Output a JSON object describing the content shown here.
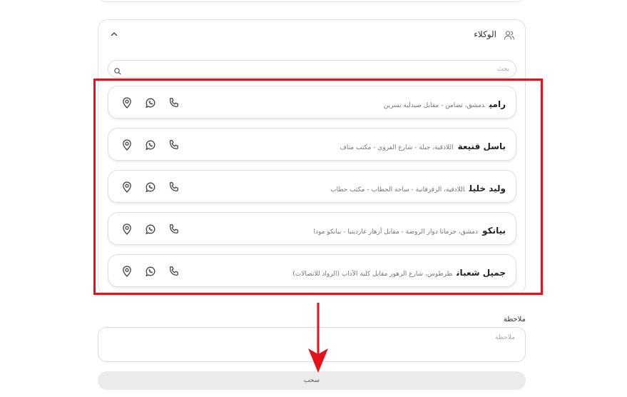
{
  "agents_section": {
    "title": "الوكلاء",
    "search_placeholder": "بحث",
    "agents": [
      {
        "name": "رامي",
        "address": "دمشق، تضامن - مقابل صيدلية نسرين"
      },
      {
        "name": "باسل قنيعة",
        "address": "اللاذقية، جبلة - شارع الفروي - مكتب مناف"
      },
      {
        "name": "وليد خليل",
        "address": "اللاذقية، الزقزقانية - ساحة الحطاب - مكتب حطاب"
      },
      {
        "name": "بيانكو",
        "address": "دمشق، جرمانا دوار الروضة - مقابل أزهار غاردينيا - بيانكو مودا"
      },
      {
        "name": "جميل شعبان",
        "address": "طرطوس، شارع الزهور مقابل كلية الآداب (الرواد للاتصالات)"
      }
    ],
    "action_icons": [
      "location-pin-icon",
      "whatsapp-icon",
      "phone-icon"
    ]
  },
  "note": {
    "label": "ملاحظة",
    "placeholder": "ملاحظة"
  },
  "submit": {
    "label": "سحب"
  },
  "annotation": {
    "highlight_color": "#e4131b"
  }
}
